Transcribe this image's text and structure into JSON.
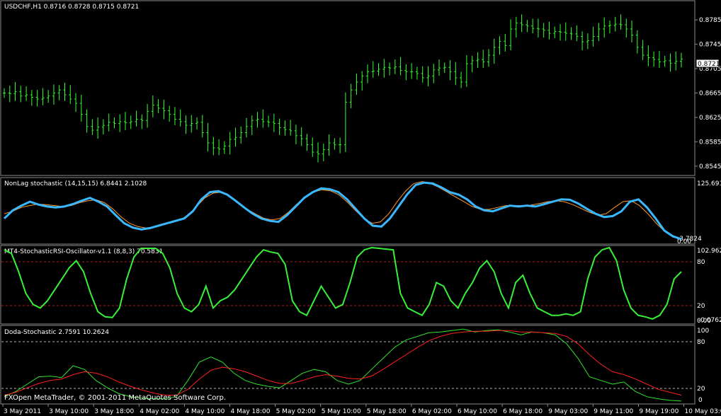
{
  "colors": {
    "background": "#000000",
    "border": "#8a8a8a",
    "price_bar": "#35ff35",
    "label": "#ffffff",
    "nonlag_fast": "#3ab8ff",
    "nonlag_slow": "#ff9a2a",
    "stochrsi": "#37f037",
    "doda_fast": "#2ee32e",
    "doda_slow": "#ff2020",
    "level_red": "#b81e1e",
    "level_white": "#b0b0b0"
  },
  "panels": {
    "price": {
      "title": "USDCHF,H1  0.8716 0.8728 0.8715 0.8721",
      "current_price": "0.8721",
      "y_range": [
        0.8532,
        0.8813
      ],
      "y_ticks": [
        "0.8785",
        "0.8745",
        "0.8705",
        "0.8665",
        "0.8625",
        "0.8585",
        "0.8545"
      ]
    },
    "nonlag": {
      "title": "NonLag stochastic (14,15,15) 6.8441 2.1028",
      "top_label": "125.6910",
      "bottom_label": "-3.7824",
      "zero_label": "0.00"
    },
    "stochrsi": {
      "title": "MT4-StochasticRSI-Oscillator-v1.1 (8,8,3) 70.5831",
      "top_label": "102.9624",
      "level_high": "80",
      "level_low": "20",
      "bottom_label": "-0.0762",
      "bottom_label2": "0.00"
    },
    "doda": {
      "title": "Doda-Stochastic 2.7591 10.2624",
      "top_label": "100",
      "level_high": "80",
      "level_low": "20",
      "bottom_label": "0"
    }
  },
  "time_axis": [
    "3 May 2011",
    "3 May 10:00",
    "3 May 18:00",
    "4 May 02:00",
    "4 May 10:00",
    "4 May 18:00",
    "5 May 02:00",
    "5 May 10:00",
    "5 May 18:00",
    "6 May 02:00",
    "6 May 10:00",
    "6 May 18:00",
    "9 May 03:00",
    "9 May 11:00",
    "9 May 19:00",
    "10 May 03:00"
  ],
  "footer": "FXOpen MetaTrader, © 2001-2011 MetaQuotes Software Corp.",
  "chart_data": [
    {
      "type": "line",
      "title": "USDCHF,H1",
      "y_range": [
        0.8532,
        0.8813
      ],
      "series": [
        {
          "name": "USDCHF",
          "values": [
            0.8665,
            0.8664,
            0.8667,
            0.866,
            0.8662,
            0.8658,
            0.8655,
            0.8657,
            0.866,
            0.8665,
            0.867,
            0.8662,
            0.8655,
            0.8648,
            0.863,
            0.861,
            0.8604,
            0.8609,
            0.8612,
            0.8617,
            0.8615,
            0.8618,
            0.8616,
            0.8618,
            0.8622,
            0.862,
            0.8635,
            0.8645,
            0.864,
            0.8636,
            0.863,
            0.8622,
            0.8618,
            0.8612,
            0.8615,
            0.8617,
            0.86,
            0.8583,
            0.8575,
            0.8573,
            0.8578,
            0.8589,
            0.8592,
            0.86,
            0.861,
            0.862,
            0.8622,
            0.8618,
            0.8617,
            0.8615,
            0.8608,
            0.8605,
            0.8603,
            0.8595,
            0.859,
            0.858,
            0.8568,
            0.8565,
            0.8572,
            0.8583,
            0.858,
            0.858,
            0.865,
            0.867,
            0.8683,
            0.8693,
            0.87,
            0.8701,
            0.8704,
            0.8707,
            0.8706,
            0.8708,
            0.8702,
            0.87,
            0.87,
            0.8697,
            0.869,
            0.8693,
            0.8703,
            0.8706,
            0.8707,
            0.87,
            0.869,
            0.8683,
            0.8713,
            0.8718,
            0.872,
            0.8716,
            0.8727,
            0.874,
            0.875,
            0.8743,
            0.877,
            0.878,
            0.8777,
            0.8775,
            0.8771,
            0.877,
            0.8768,
            0.8763,
            0.8766,
            0.8765,
            0.8763,
            0.8762,
            0.8758,
            0.8749,
            0.8751,
            0.8758,
            0.877,
            0.8775,
            0.8776,
            0.8778,
            0.8777,
            0.877,
            0.876,
            0.874,
            0.8727,
            0.8723,
            0.872,
            0.8716,
            0.8718,
            0.8714,
            0.8717,
            0.8721
          ]
        }
      ]
    },
    {
      "type": "line",
      "title": "NonLag stochastic (14,15,15)",
      "series": [
        {
          "name": "fast",
          "values": [
            45,
            62,
            72,
            80,
            74,
            70,
            68,
            70,
            75,
            82,
            88,
            80,
            70,
            52,
            35,
            26,
            22,
            25,
            30,
            35,
            40,
            45,
            60,
            85,
            100,
            102,
            95,
            82,
            68,
            55,
            45,
            40,
            38,
            52,
            70,
            88,
            100,
            108,
            106,
            100,
            85,
            65,
            45,
            30,
            28,
            45,
            70,
            95,
            115,
            120,
            118,
            110,
            100,
            95,
            85,
            70,
            62,
            60,
            66,
            72,
            70,
            72,
            70,
            75,
            80,
            85,
            84,
            76,
            65,
            55,
            48,
            50,
            60,
            80,
            85,
            68,
            45,
            20,
            8,
            2
          ]
        },
        {
          "name": "slow",
          "values": [
            55,
            60,
            68,
            72,
            75,
            74,
            72,
            70,
            72,
            78,
            82,
            84,
            78,
            65,
            48,
            35,
            28,
            25,
            28,
            32,
            36,
            42,
            52,
            70,
            88,
            98,
            100,
            92,
            78,
            65,
            55,
            46,
            42,
            45,
            58,
            75,
            90,
            100,
            105,
            103,
            95,
            80,
            62,
            45,
            35,
            38,
            55,
            80,
            102,
            118,
            122,
            118,
            110,
            100,
            90,
            80,
            70,
            64,
            64,
            68,
            72,
            72,
            72,
            73,
            76,
            80,
            82,
            80,
            74,
            66,
            58,
            52,
            55,
            68,
            80,
            82,
            72,
            55,
            35,
            18,
            6,
            2
          ]
        }
      ]
    },
    {
      "type": "line",
      "title": "MT4-StochasticRSI-Oscillator-v1.1 (8,8,3)",
      "series": [
        {
          "name": "stochrsi",
          "values": [
            100,
            95,
            70,
            40,
            25,
            20,
            30,
            45,
            60,
            75,
            85,
            70,
            40,
            15,
            8,
            7,
            20,
            60,
            90,
            102,
            102,
            102,
            95,
            75,
            40,
            20,
            15,
            25,
            50,
            20,
            30,
            35,
            45,
            60,
            75,
            90,
            100,
            97,
            95,
            80,
            30,
            15,
            10,
            30,
            50,
            35,
            20,
            25,
            55,
            90,
            100,
            103,
            102,
            101,
            100,
            40,
            20,
            15,
            10,
            25,
            55,
            50,
            30,
            20,
            40,
            55,
            75,
            85,
            70,
            40,
            20,
            55,
            65,
            40,
            20,
            15,
            10,
            10,
            12,
            10,
            15,
            60,
            90,
            100,
            103,
            85,
            45,
            20,
            10,
            8,
            5,
            10,
            25,
            60,
            70
          ]
        }
      ]
    },
    {
      "type": "line",
      "title": "Doda-Stochastic",
      "series": [
        {
          "name": "fast",
          "values": [
            8,
            15,
            25,
            35,
            36,
            34,
            50,
            45,
            30,
            20,
            12,
            8,
            6,
            5,
            5,
            8,
            30,
            55,
            62,
            55,
            40,
            30,
            25,
            22,
            20,
            30,
            40,
            45,
            42,
            30,
            25,
            30,
            45,
            60,
            75,
            85,
            90,
            95,
            96,
            98,
            100,
            96,
            98,
            99,
            96,
            92,
            96,
            95,
            92,
            80,
            60,
            35,
            30,
            25,
            28,
            15,
            8,
            5,
            3,
            2
          ]
        },
        {
          "name": "slow",
          "values": [
            10,
            14,
            20,
            26,
            30,
            32,
            38,
            42,
            40,
            35,
            28,
            22,
            17,
            13,
            10,
            10,
            18,
            32,
            44,
            48,
            46,
            42,
            36,
            30,
            26,
            26,
            30,
            35,
            38,
            36,
            33,
            32,
            36,
            45,
            55,
            65,
            75,
            84,
            90,
            94,
            96,
            97,
            97,
            98,
            98,
            96,
            96,
            95,
            94,
            90,
            80,
            65,
            52,
            42,
            38,
            32,
            25,
            18,
            14,
            10
          ]
        }
      ]
    }
  ]
}
